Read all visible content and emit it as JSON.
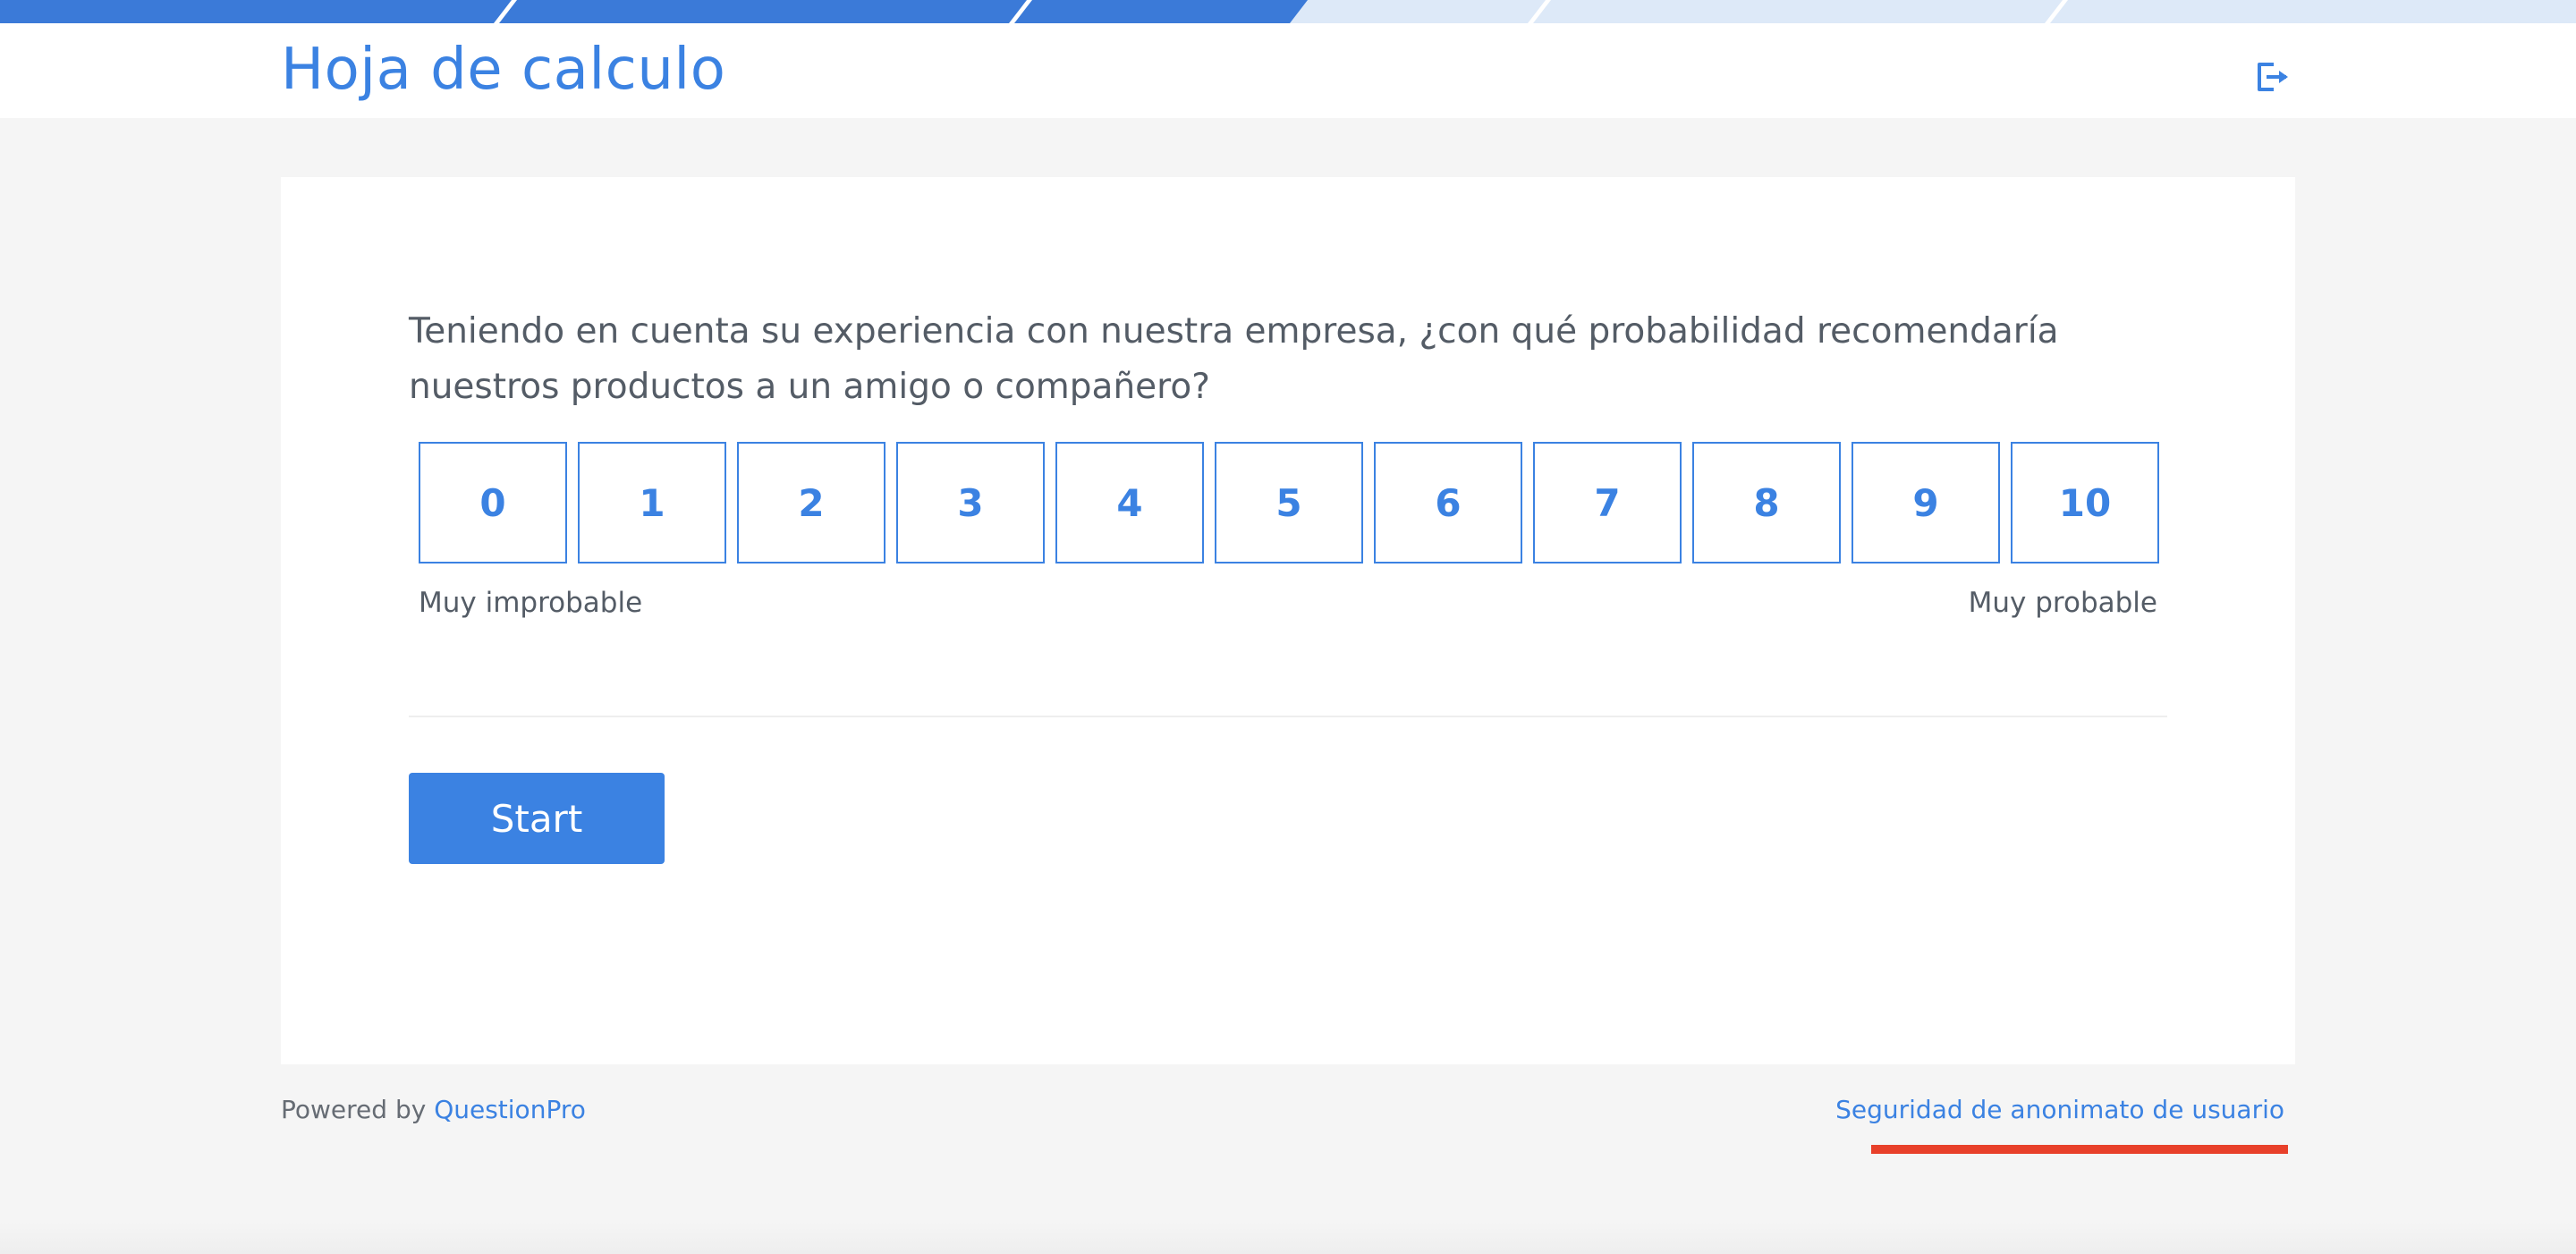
{
  "survey": {
    "title": "Hoja de calculo",
    "exit_icon": "exit-icon"
  },
  "question": {
    "text": "Teniendo en cuenta su experiencia con nuestra empresa, ¿con qué probabilidad recomendaría nuestros productos a un amigo o compañero?",
    "scale": [
      "0",
      "1",
      "2",
      "3",
      "4",
      "5",
      "6",
      "7",
      "8",
      "9",
      "10"
    ],
    "anchor_low": "Muy improbable",
    "anchor_high": "Muy probable"
  },
  "actions": {
    "start_label": "Start"
  },
  "footer": {
    "powered_by": "Powered by",
    "brand": "QuestionPro",
    "anonymity_link": "Seguridad de anonimato de usuario"
  },
  "colors": {
    "accent": "#3b82e2",
    "stripe_light": "#dde9f8",
    "highlight_underline": "#e8402a",
    "background": "#f5f5f5"
  }
}
